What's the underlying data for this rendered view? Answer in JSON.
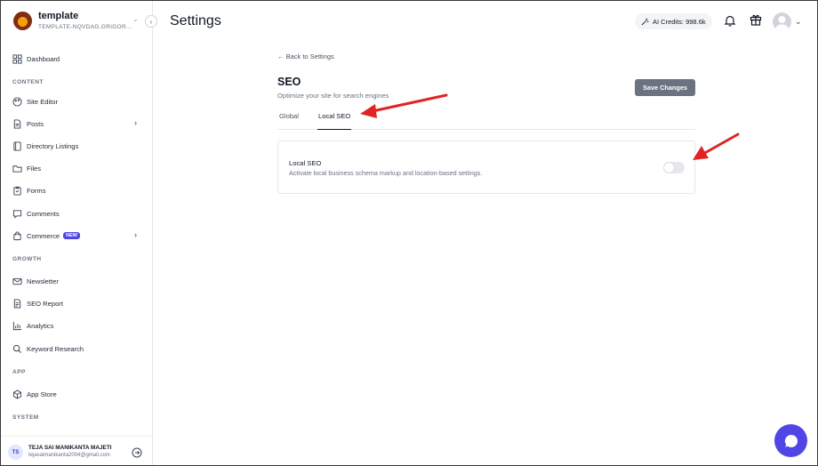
{
  "site": {
    "name": "template",
    "subdomain": "TEMPLATE-NQVDAG.GRIGOR..."
  },
  "nav": {
    "dashboard": "Dashboard",
    "content_label": "CONTENT",
    "site_editor": "Site Editor",
    "posts": "Posts",
    "directory_listings": "Directory Listings",
    "files": "Files",
    "forms": "Forms",
    "comments": "Comments",
    "commerce": "Commerce",
    "commerce_badge": "NEW",
    "growth_label": "GROWTH",
    "newsletter": "Newsletter",
    "seo_report": "SEO Report",
    "analytics": "Analytics",
    "keyword_research": "Keyword Research",
    "app_label": "APP",
    "app_store": "App Store",
    "system_label": "SYSTEM"
  },
  "user": {
    "initials": "TS",
    "name": "TEJA SAI MANIKANTA MAJETI",
    "email": "tejasaimanikanta2004@gmail.com"
  },
  "header": {
    "title": "Settings",
    "credits": "AI Credits: 998.6k"
  },
  "page": {
    "back": "← Back to Settings",
    "title": "SEO",
    "subtitle": "Optimize your site for search engines",
    "save_label": "Save Changes",
    "tabs": [
      {
        "label": "Global"
      },
      {
        "label": "Local SEO"
      }
    ],
    "active_tab": "Local SEO",
    "card": {
      "title": "Local SEO",
      "description": "Activate local business schema markup and location-based settings.",
      "toggle_on": false
    }
  },
  "colors": {
    "accent": "#4f46e5",
    "annotation_arrow": "#e02424",
    "save_button": "#6b7280"
  }
}
